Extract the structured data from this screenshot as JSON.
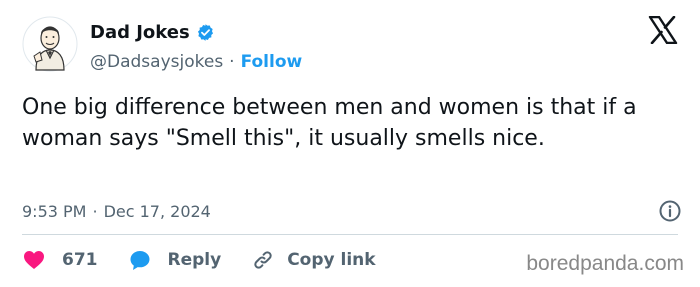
{
  "author": {
    "display_name": "Dad Jokes",
    "handle": "@Dadsaysjokes",
    "separator": "·",
    "follow_label": "Follow"
  },
  "tweet": {
    "text": "One big difference between men and women is that if a woman says \"Smell this\", it usually smells nice.",
    "time": "9:53 PM",
    "separator": "·",
    "date": "Dec 17, 2024"
  },
  "actions": {
    "like_count": "671",
    "reply_label": "Reply",
    "copy_link_label": "Copy link"
  },
  "watermark": "boredpanda.com",
  "colors": {
    "accent": "#1d9bf0",
    "like": "#f91880",
    "text": "#0f1419",
    "muted": "#536471"
  },
  "icons": [
    "avatar",
    "verified-badge-icon",
    "x-logo-icon",
    "info-icon",
    "heart-icon",
    "reply-bubble-icon",
    "link-icon"
  ]
}
